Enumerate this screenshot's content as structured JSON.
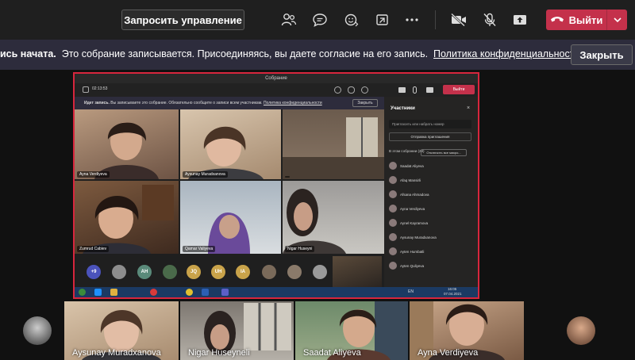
{
  "toolbar": {
    "request_control_label": "Запросить управление",
    "leave_label": "Выйти",
    "colors": {
      "leave": "#c4314b",
      "background": "#1f1f1f"
    }
  },
  "banner": {
    "bold_text": "ись начата.",
    "text": "Это собрание записывается. Присоединяясь, вы даете согласие на его запись.",
    "link_text": "Политика конфиденциальности",
    "close_label": "Закрыть"
  },
  "shared_screen": {
    "window_title": "Собрание",
    "timer": "02:13:53",
    "rec_banner_bold": "Идет запись.",
    "rec_banner_text": "Вы записываете это собрание. Обязательно сообщите о записи всем участникам.",
    "rec_banner_link": "Политика конфиденциальности",
    "rec_close_label": "Закрыть",
    "leave_label": "Выйти",
    "tiles": [
      {
        "name": "Ayna Verdiyeva"
      },
      {
        "name": "Aysunay Muradxanova"
      },
      {
        "name": ""
      },
      {
        "name": "Zumrud Cabiev"
      },
      {
        "name": "Qamar Valiyeva"
      },
      {
        "name": "Nigar Huseyni"
      }
    ],
    "avatars": [
      "+9",
      "AH",
      "JQ",
      "UH",
      "IA"
    ],
    "participants_panel": {
      "title": "Участники",
      "search_placeholder": "Пригласить или набрать номер",
      "invite_label": "Отправка приглашения",
      "group_label": "В этом собрании (28)",
      "mute_all_label": "Отключить все микро...",
      "people": [
        "Saadat Aliyeva",
        "Afaq Mansirli",
        "Afsana Ahmadova",
        "Ayna Verdiyeva",
        "Aynel Kayramova",
        "Aysunay Muradxanova",
        "Ayten Humbatli",
        "Ayten Quliyeva"
      ]
    },
    "taskbar_time": "16:05",
    "taskbar_date": "07.04.2021",
    "taskbar_lang": "EN"
  },
  "bottom_tiles": [
    {
      "name": "Aysunay Muradxanova"
    },
    {
      "name": "Nigar Huseyneli"
    },
    {
      "name": "Saadat Aliyeva"
    },
    {
      "name": "Ayna Verdiyeva"
    }
  ],
  "icons": {
    "participants": "people-icon",
    "chat": "chat-icon",
    "reactions": "reactions-icon",
    "share_tray": "share-tray-icon",
    "more": "more-icon",
    "camera": "camera-off-icon",
    "mic": "mic-off-icon",
    "share": "share-icon",
    "hangup": "phone-hangup-icon"
  }
}
